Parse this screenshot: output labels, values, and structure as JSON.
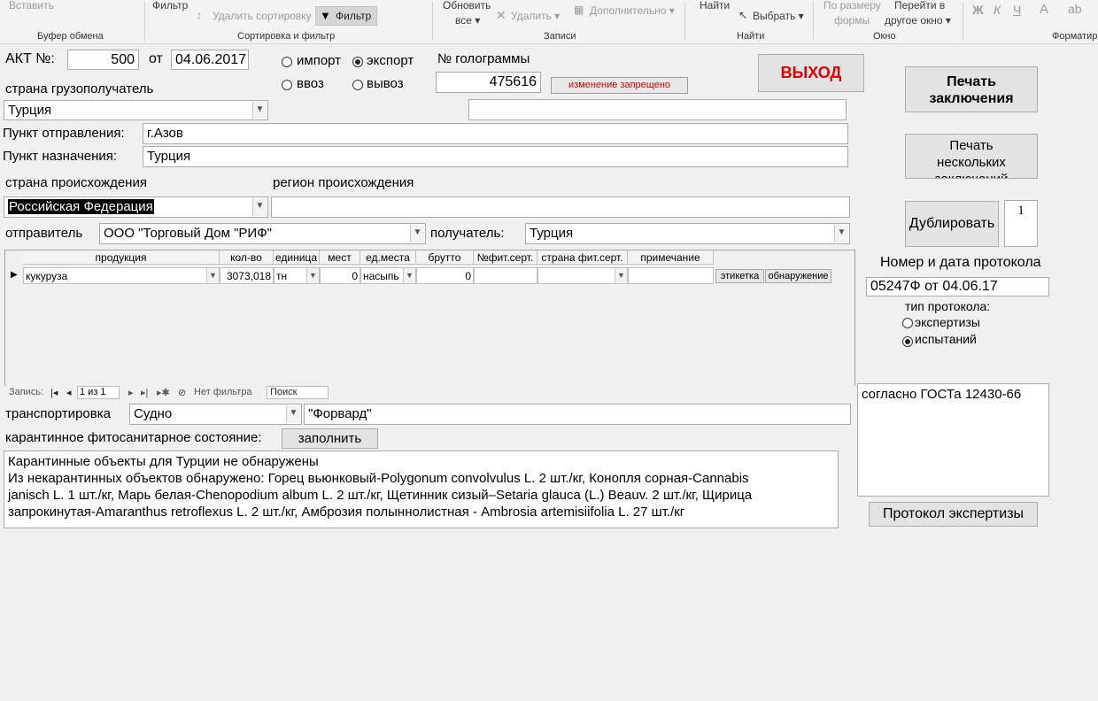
{
  "ribbon": {
    "paste": "Вставить",
    "filter": "Фильтр",
    "remove_sort": "Удалить сортировку",
    "filter_toggle": "Фильтр",
    "refresh_line1": "Обновить",
    "refresh_line2": "все",
    "delete": "Удалить",
    "more": "Дополнительно",
    "find": "Найти",
    "select": "Выбрать",
    "fit_line1": "По размеру",
    "fit_line2": "формы",
    "switch_line1": "Перейти в",
    "switch_line2": "другое окно",
    "bold": "Ж",
    "italic": "К",
    "underline": "Ч",
    "font_color": "A",
    "groups": [
      "Буфер обмена",
      "Сортировка и фильтр",
      "Записи",
      "Найти",
      "Окно",
      "Форматир"
    ]
  },
  "act": {
    "label": "АКТ №:",
    "number": "500",
    "date_label": "от",
    "date": "04.06.2017"
  },
  "direction": {
    "import": "импорт",
    "export": "экспорт",
    "entry": "ввоз",
    "exit": "вывоз",
    "selected_export": true
  },
  "hologram": {
    "label": "№ голограммы",
    "value": "475616",
    "locked": "изменение запрещено"
  },
  "exit_button": "ВЫХОД",
  "consignee_country": {
    "label": "страна грузополучатель",
    "value": "Турция",
    "extra": ""
  },
  "departure": {
    "label": "Пункт отправления:",
    "value": "г.Азов"
  },
  "destination": {
    "label": "Пункт назначения:",
    "value": "Турция"
  },
  "origin": {
    "country_label": "страна происхождения",
    "country_value": "Российская Федерация",
    "region_label": "регион происхождения",
    "region_value": ""
  },
  "sender": {
    "label": "отправитель",
    "value": "ООО \"Торговый Дом \"РИФ\""
  },
  "recipient": {
    "label": "получатель:",
    "value": "Турция"
  },
  "grid": {
    "headers": [
      "продукция",
      "кол-во",
      "единица",
      "мест",
      "ед.места",
      "брутто",
      "№фит.серт.",
      "страна фит.серт.",
      "примечание"
    ],
    "row": {
      "product": "кукуруза",
      "qty": "3073,018",
      "unit": "тн",
      "places": "0",
      "place_unit": "насыпь",
      "gross": "0",
      "cert_no": "",
      "cert_country": "",
      "note": "",
      "label_btn": "этикетка",
      "detect_btn": "обнаружение"
    }
  },
  "nav": {
    "record_label": "Запись:",
    "position": "1 из 1",
    "no_filter": "Нет фильтра",
    "search": "Поиск"
  },
  "transport": {
    "label": "транспортировка",
    "type": "Судно",
    "name": "\"Форвард\""
  },
  "phyto": {
    "label": "карантинное фитосанитарное состояние:",
    "fill_button": "заполнить",
    "text_line1": "Карантинные объекты для Турции не обнаружены",
    "text_line2": "Из некарантинных объектов обнаружено: Горец вьюнковый-Polygonum convolvulus L. 2 шт./кг, Конопля сорная-Cannabis",
    "text_line3": "janisch L. 1 шт./кг, Марь белая-Chenopodium album L. 2 шт./кг, Щетинник сизый–Setaria glauca (L.) Beauv. 2 шт./кг, Щирица",
    "text_line4": "запрокинутая-Amaranthus retroflexus L. 2 шт./кг, Амброзия полыннолистная - Ambrosia artemisiifolia L. 27 шт./кг"
  },
  "right": {
    "print_conclusion_1": "Печать",
    "print_conclusion_2": "заключения",
    "print_multi_1": "Печать",
    "print_multi_2": "нескольких",
    "print_multi_3": "заключений",
    "duplicate": "Дублировать",
    "dup_count": "1",
    "protocol_label": "Номер и дата протокола",
    "protocol_value": "05247Ф от 04.06.17",
    "protocol_type_label": "тип протокола:",
    "type_expertise": "экспертизы",
    "type_tests": "испытаний",
    "selected_tests": true,
    "gost_text": "согласно ГОСТа 12430-66",
    "expertise_button": "Протокол экспертизы"
  }
}
